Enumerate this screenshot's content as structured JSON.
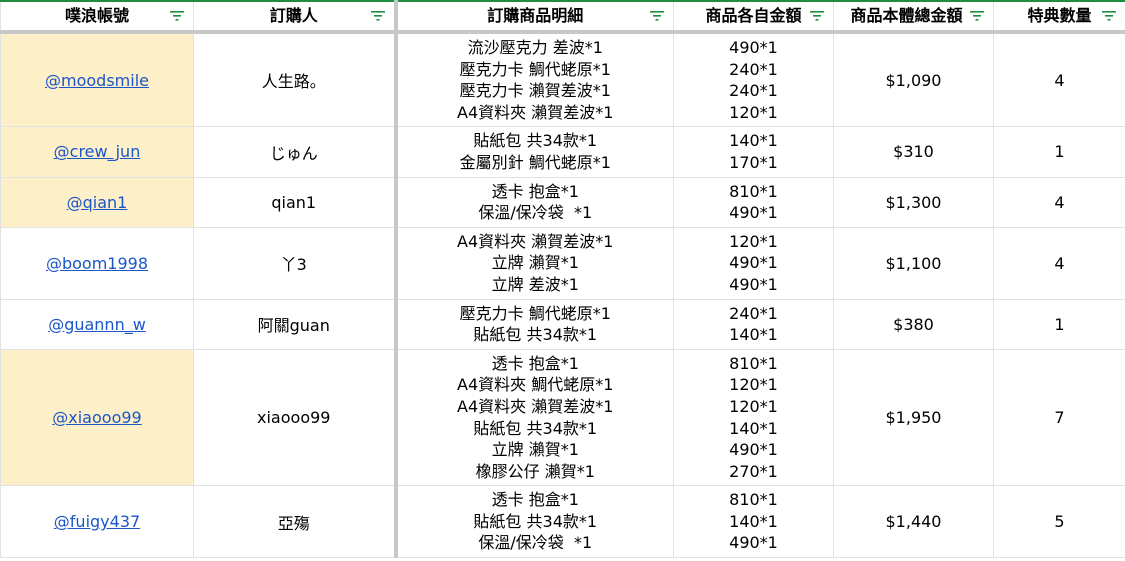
{
  "headers": {
    "account": "噗浪帳號",
    "buyer": "訂購人",
    "items": "訂購商品明細",
    "prices": "商品各自金額",
    "total": "商品本體總金額",
    "bonus": "特典數量"
  },
  "rows": [
    {
      "account": "@moodsmile",
      "highlight": true,
      "buyer": "人生路。",
      "items": [
        "流沙壓克力 差波*1",
        "壓克力卡 鯛代蛯原*1",
        "壓克力卡 瀨賀差波*1",
        "A4資料夾 瀨賀差波*1"
      ],
      "prices": [
        "490*1",
        "240*1",
        "240*1",
        "120*1"
      ],
      "total": "$1,090",
      "bonus": "4"
    },
    {
      "account": "@crew_jun",
      "highlight": true,
      "buyer": "じゅん",
      "items": [
        "貼紙包 共34款*1",
        "金屬別針 鯛代蛯原*1"
      ],
      "prices": [
        "140*1",
        "170*1"
      ],
      "total": "$310",
      "bonus": "1"
    },
    {
      "account": "@qian1",
      "highlight": true,
      "buyer": "qian1",
      "items": [
        "透卡 抱盒*1",
        "保溫/保冷袋  *1"
      ],
      "prices": [
        "810*1",
        "490*1"
      ],
      "total": "$1,300",
      "bonus": "4"
    },
    {
      "account": "@boom1998",
      "highlight": false,
      "buyer": "丫3",
      "items": [
        "A4資料夾 瀨賀差波*1",
        "立牌 瀨賀*1",
        "立牌 差波*1"
      ],
      "prices": [
        "120*1",
        "490*1",
        "490*1"
      ],
      "total": "$1,100",
      "bonus": "4"
    },
    {
      "account": "@guannn_w",
      "highlight": false,
      "buyer": "阿關guan",
      "items": [
        "壓克力卡 鯛代蛯原*1",
        "貼紙包 共34款*1"
      ],
      "prices": [
        "240*1",
        "140*1"
      ],
      "total": "$380",
      "bonus": "1"
    },
    {
      "account": "@xiaooo99",
      "highlight": true,
      "buyer": "xiaooo99",
      "items": [
        "透卡 抱盒*1",
        "A4資料夾 鯛代蛯原*1",
        "A4資料夾 瀨賀差波*1",
        "貼紙包 共34款*1",
        "立牌 瀨賀*1",
        "橡膠公仔 瀨賀*1"
      ],
      "prices": [
        "810*1",
        "120*1",
        "120*1",
        "140*1",
        "490*1",
        "270*1"
      ],
      "total": "$1,950",
      "bonus": "7"
    },
    {
      "account": "@fuigy437",
      "highlight": false,
      "buyer": "亞殤",
      "items": [
        "透卡 抱盒*1",
        "貼紙包 共34款*1",
        "保溫/保冷袋  *1"
      ],
      "prices": [
        "810*1",
        "140*1",
        "490*1"
      ],
      "total": "$1,440",
      "bonus": "5"
    }
  ],
  "colors": {
    "link": "#1a56c8",
    "highlight": "#fdefc8",
    "filter_icon": "#1e8e3e",
    "header_border": "#1e8e3e"
  }
}
